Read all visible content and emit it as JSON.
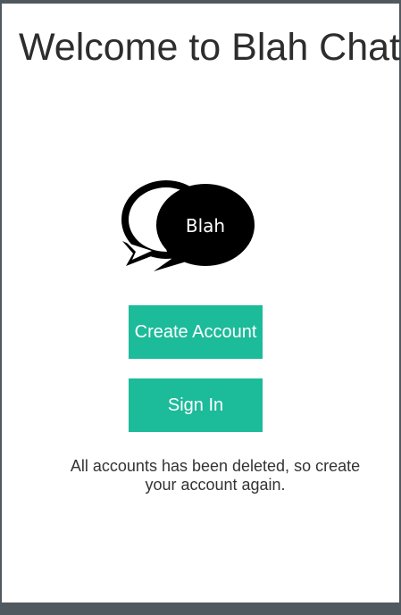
{
  "title": "Welcome to Blah Chat",
  "logo": {
    "text": "Blah",
    "icon": "chat-bubbles-icon",
    "bubble_color": "#000000",
    "text_color": "#ffffff"
  },
  "buttons": {
    "create_account": "Create Account",
    "sign_in": "Sign In",
    "color": "#1cbb9a"
  },
  "notice": "All accounts has been deleted, so create your account again.",
  "colors": {
    "border": "#50595f",
    "background": "#ffffff",
    "text": "#2d2d2d"
  }
}
